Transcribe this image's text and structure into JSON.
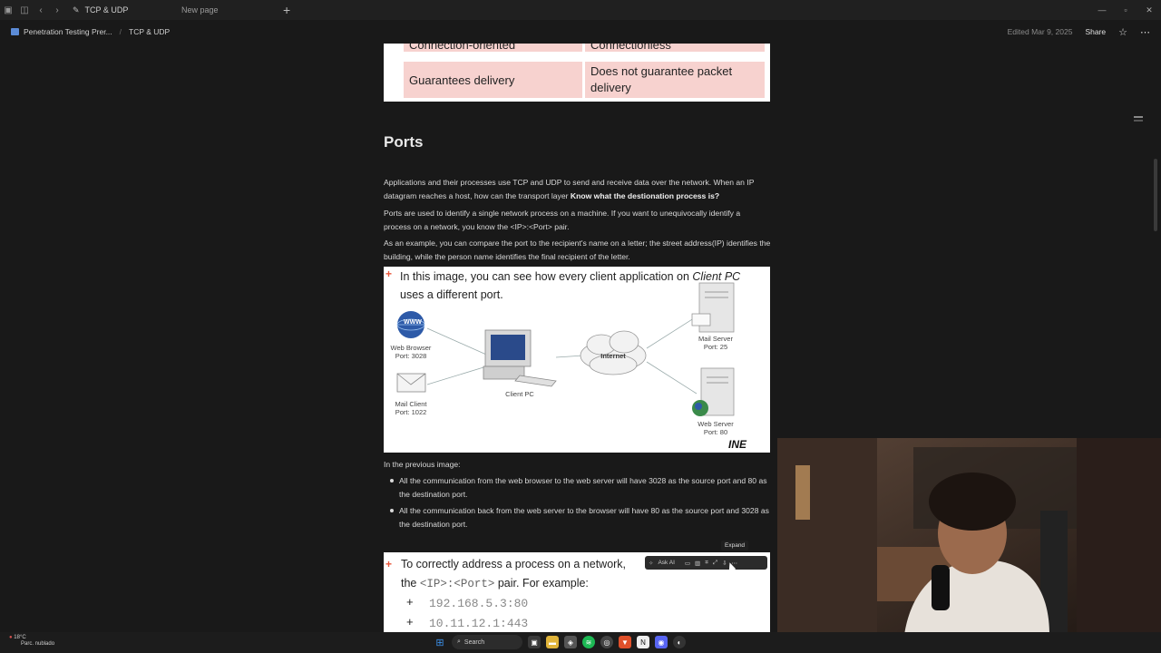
{
  "titlebar": {
    "tabs": [
      {
        "label": "TCP & UDP",
        "active": true
      },
      {
        "label": "New page",
        "active": false
      }
    ]
  },
  "breadcrumb": {
    "items": [
      "Penetration Testing Prer...",
      "TCP & UDP"
    ],
    "edited": "Edited Mar 9, 2025",
    "share": "Share"
  },
  "table": {
    "row1": {
      "col1": "Connection-oriented",
      "col2": "Connectionless"
    },
    "row2": {
      "col1": "Guarantees delivery",
      "col2": "Does not guarantee packet delivery"
    }
  },
  "section": {
    "heading": "Ports",
    "p1_start": "Applications and their processes use TCP and UDP to send and receive data over the network. When an IP datagram reaches a host, how can the transport layer ",
    "p1_bold": "Know what the destionation process is?",
    "p2": "Ports are used to identify a single network process on a machine. If you want to unequivocally identify a process on a network, you know the <IP>:<Port> pair.",
    "p3": "As an example, you can compare the port to the recipient's name on a letter; the street address(IP) identifies the building, while the person name identifies the final recipient of the letter."
  },
  "image1": {
    "caption_a": "In this image, you can see how every client application on ",
    "caption_em": "Client PC",
    "caption_b": " uses a different port.",
    "labels": {
      "web_browser": "Web Browser",
      "web_browser_port": "Port: 3028",
      "mail_client": "Mail Client",
      "mail_client_port": "Port: 1022",
      "client_pc": "Client PC",
      "internet": "Internet",
      "mail_server": "Mail Server",
      "mail_server_port": "Port: 25",
      "web_server": "Web Server",
      "web_server_port": "Port: 80",
      "www": "WWW",
      "logo": "INE"
    }
  },
  "after_image": {
    "intro": "In the previous image:",
    "bullets": [
      "All the communication from the web browser to the web server will have 3028 as the source port and 80 as the destination port.",
      "All the communication back from the web server to the browser will have 80 as the source port and 3028 as the destination port."
    ]
  },
  "image2": {
    "line1": "To correctly address a process on a network,",
    "line2_a": "the ",
    "line2_mono": "<IP>:<Port>",
    "line2_b": " pair. For example:",
    "addresses": [
      "192.168.5.3:80",
      "10.11.12.1:443"
    ]
  },
  "image_toolbar": {
    "ask_ai": "Ask AI",
    "tooltip": "Expand"
  },
  "taskbar": {
    "weather_temp": "18°C",
    "weather_desc": "Parc. nublado",
    "search": "Search"
  },
  "colors": {
    "background": "#191919",
    "table_cell": "#f7d2cf",
    "accent_plus": "#e8553a"
  }
}
